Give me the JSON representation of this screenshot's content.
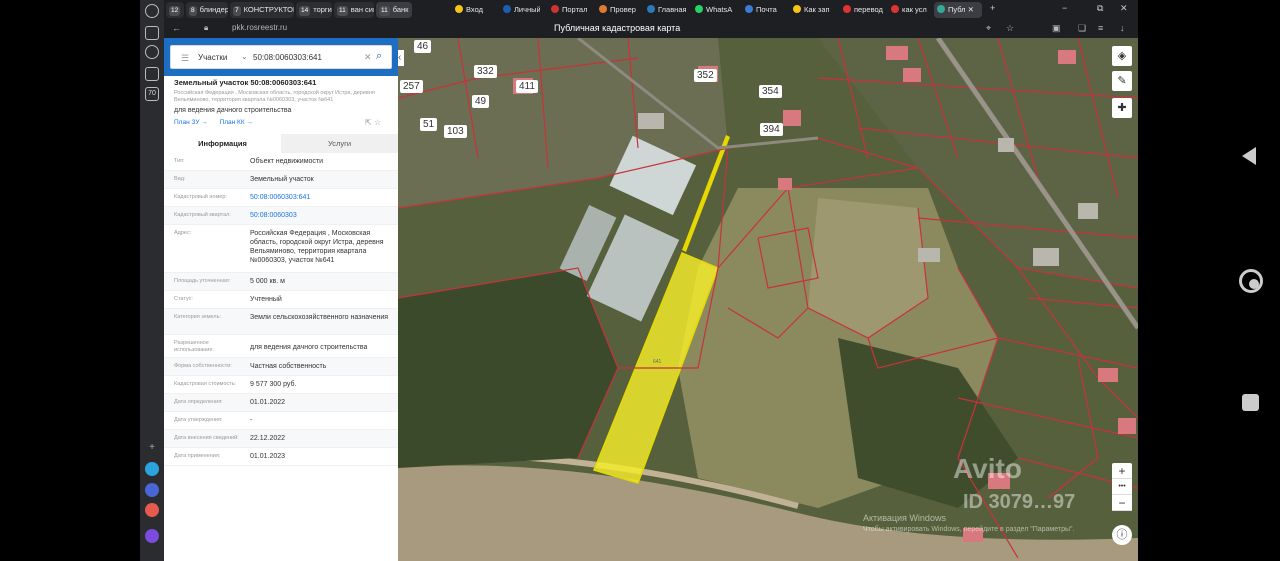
{
  "browser": {
    "tabs": [
      {
        "num": "12",
        "label": ""
      },
      {
        "num": "8",
        "label": "блиндер"
      },
      {
        "num": "7",
        "label": "КОНСТРУКТОР"
      },
      {
        "num": "14",
        "label": "торги"
      },
      {
        "num": "11",
        "label": "ван сим"
      },
      {
        "num": "11",
        "label": "банк"
      },
      {
        "num": "",
        "label": "Вход"
      },
      {
        "num": "",
        "label": "Личный"
      },
      {
        "num": "",
        "label": "Портал"
      },
      {
        "num": "",
        "label": "Провер"
      },
      {
        "num": "",
        "label": "Главная"
      },
      {
        "num": "",
        "label": "WhatsA"
      },
      {
        "num": "",
        "label": "Почта"
      },
      {
        "num": "",
        "label": "Как зап"
      },
      {
        "num": "",
        "label": "перевод"
      },
      {
        "num": "",
        "label": "как усл"
      },
      {
        "num": "",
        "label": "Публ"
      }
    ],
    "url": "pkk.rosreestr.ru",
    "page_title": "Публичная кадастровая карта"
  },
  "search": {
    "category": "Участки",
    "query": "50:08:0060303:641"
  },
  "object": {
    "title": "Земельный участок 50:08:0060303:641",
    "address_small": "Российская Федерация , Московская область, городской округ Истра, деревня Вельяминово, территория квартала №0060303, участок №641",
    "purpose": "для ведения дачного строительства",
    "link_zu": "План ЗУ →",
    "link_kk": "План КК →"
  },
  "tabs": {
    "info": "Информация",
    "services": "Услуги"
  },
  "rows": [
    {
      "k": "Тип:",
      "v": "Объект недвижимости"
    },
    {
      "k": "Вид:",
      "v": "Земельный участок"
    },
    {
      "k": "Кадастровый номер:",
      "v": "50:08:0060303:641",
      "link": true
    },
    {
      "k": "Кадастровый квартал:",
      "v": "50:08:0060303",
      "link": true
    },
    {
      "k": "Адрес:",
      "v": "Российская Федерация , Московская область, городской округ Истра, деревня Вельяминово, территория квартала №0060303, участок №641"
    },
    {
      "k": "Площадь уточненная:",
      "v": "5 000 кв. м"
    },
    {
      "k": "Статус:",
      "v": "Учтенный"
    },
    {
      "k": "Категория земель:",
      "v": "Земли сельскохозяйственного назначения"
    },
    {
      "k": "Разрешенное использование:",
      "v": "для ведения дачного строительства"
    },
    {
      "k": "Форма собственности:",
      "v": "Частная собственность"
    },
    {
      "k": "Кадастровая стоимость:",
      "v": "9 577 300 руб."
    },
    {
      "k": "Дата определения:",
      "v": "01.01.2022"
    },
    {
      "k": "Дата утверждения:",
      "v": "-"
    },
    {
      "k": "Дата внесения сведений:",
      "v": "22.12.2022"
    },
    {
      "k": "Дата применения:",
      "v": "01.01.2023"
    }
  ],
  "map": {
    "house_numbers": [
      "46",
      "257",
      "332",
      "411",
      "352",
      "354",
      "49",
      "394",
      "103",
      "51"
    ],
    "parcel_label": "641",
    "watermark_line1": "Активация Windows",
    "watermark_line2": "Чтобы активировать Windows, перейдите в раздел \"Параметры\".",
    "avito_text": "Avito",
    "avito_id": "ID 3079…97",
    "zoom_in": "+",
    "zoom_dots": "•••",
    "zoom_out": "−",
    "colors": {
      "parcel_fill": "#f5ee2a",
      "boundary": "#c8323c",
      "vegetation": "#4e5a36"
    }
  }
}
